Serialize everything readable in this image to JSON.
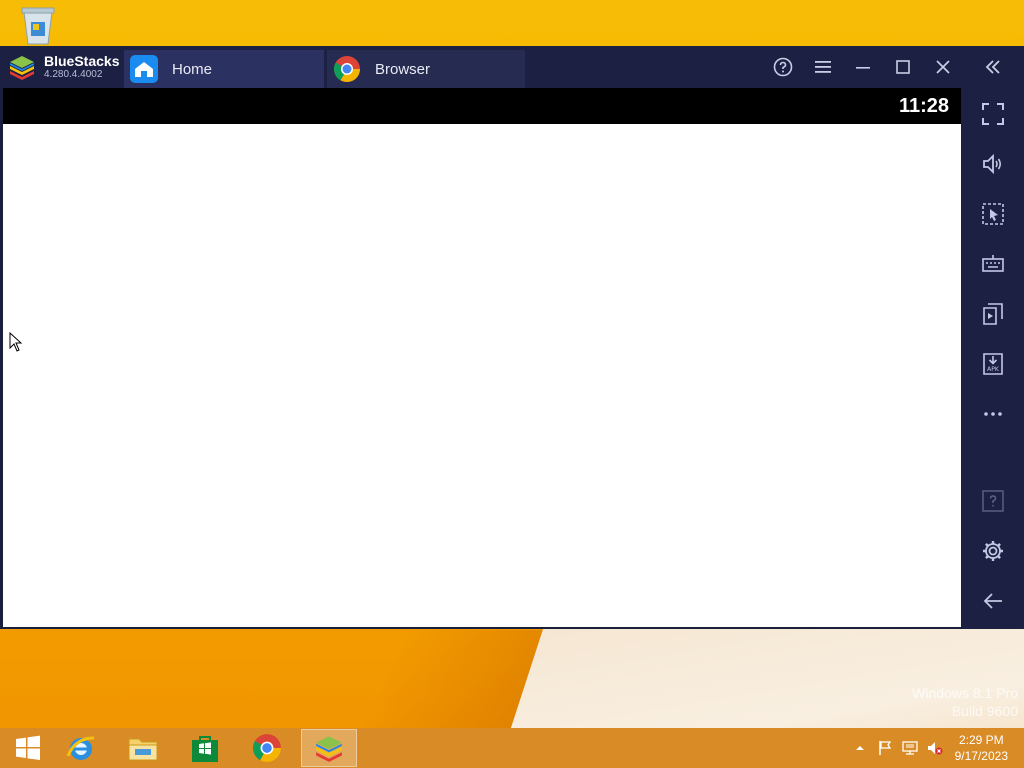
{
  "window": {
    "app_name": "BlueStacks",
    "version": "4.280.4.4002"
  },
  "tabs": [
    {
      "label": "Home",
      "icon": "home-icon"
    },
    {
      "label": "Browser",
      "icon": "chrome-icon"
    }
  ],
  "android": {
    "clock": "11:28"
  },
  "desktop": {
    "watermark_line1": "Windows 8.1 Pro",
    "watermark_line2": "Build 9600"
  },
  "taskbar": {
    "time": "2:29 PM",
    "date": "9/17/2023"
  },
  "colors": {
    "titlebar": "#1c2143",
    "accent": "#f5ac00"
  }
}
